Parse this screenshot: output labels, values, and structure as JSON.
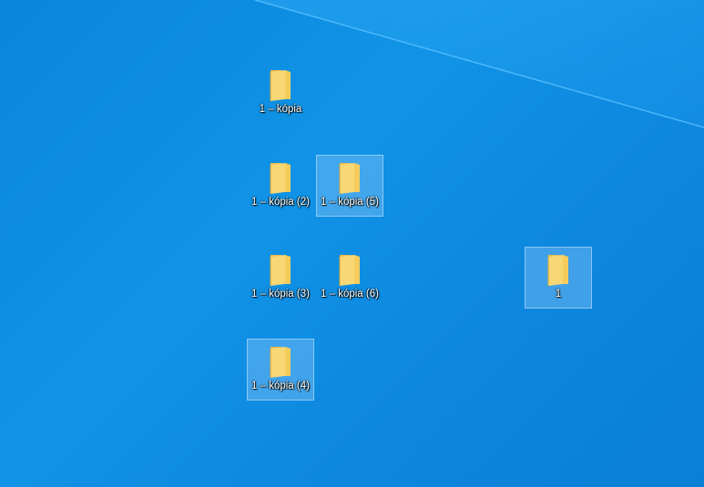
{
  "desktop": {
    "background_color": "#0d8ae0",
    "icons": [
      {
        "label": "1 – kópia",
        "icon": "folder-icon",
        "selected": false
      },
      {
        "label": "1 – kópia (2)",
        "icon": "folder-icon",
        "selected": false
      },
      {
        "label": "1 – kópia (5)",
        "icon": "folder-icon",
        "selected": true
      },
      {
        "label": "1 – kópia (3)",
        "icon": "folder-icon",
        "selected": false
      },
      {
        "label": "1 – kópia (6)",
        "icon": "folder-icon",
        "selected": false
      },
      {
        "label": "1",
        "icon": "folder-icon",
        "selected": true
      },
      {
        "label": "1 – kópia (4)",
        "icon": "folder-icon",
        "selected": true
      }
    ]
  }
}
